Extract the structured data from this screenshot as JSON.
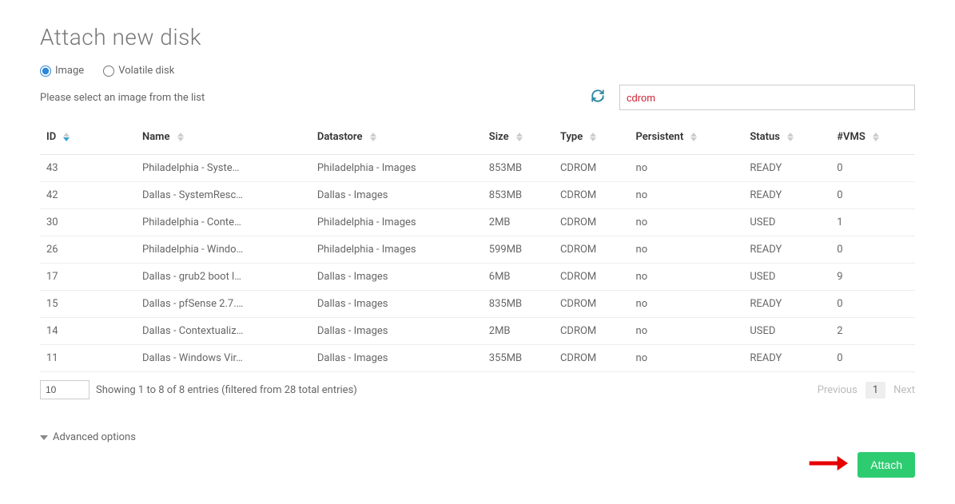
{
  "title": "Attach new disk",
  "radios": {
    "image": "Image",
    "volatile": "Volatile disk",
    "selected": "image"
  },
  "prompt": "Please select an image from the list",
  "search": {
    "value": "cdrom",
    "placeholder": ""
  },
  "columns": [
    "ID",
    "Name",
    "Datastore",
    "Size",
    "Type",
    "Persistent",
    "Status",
    "#VMS"
  ],
  "rows": [
    {
      "id": "43",
      "name": "Philadelphia - Syste…",
      "datastore": "Philadelphia - Images",
      "size": "853MB",
      "type": "CDROM",
      "persistent": "no",
      "status": "READY",
      "vms": "0"
    },
    {
      "id": "42",
      "name": "Dallas - SystemResc…",
      "datastore": "Dallas - Images",
      "size": "853MB",
      "type": "CDROM",
      "persistent": "no",
      "status": "READY",
      "vms": "0"
    },
    {
      "id": "30",
      "name": "Philadelphia - Conte…",
      "datastore": "Philadelphia - Images",
      "size": "2MB",
      "type": "CDROM",
      "persistent": "no",
      "status": "USED",
      "vms": "1"
    },
    {
      "id": "26",
      "name": "Philadelphia - Windo…",
      "datastore": "Philadelphia - Images",
      "size": "599MB",
      "type": "CDROM",
      "persistent": "no",
      "status": "READY",
      "vms": "0"
    },
    {
      "id": "17",
      "name": "Dallas - grub2 boot l…",
      "datastore": "Dallas - Images",
      "size": "6MB",
      "type": "CDROM",
      "persistent": "no",
      "status": "USED",
      "vms": "9"
    },
    {
      "id": "15",
      "name": "Dallas - pfSense 2.7.…",
      "datastore": "Dallas - Images",
      "size": "835MB",
      "type": "CDROM",
      "persistent": "no",
      "status": "READY",
      "vms": "0"
    },
    {
      "id": "14",
      "name": "Dallas - Contextualiz…",
      "datastore": "Dallas - Images",
      "size": "2MB",
      "type": "CDROM",
      "persistent": "no",
      "status": "USED",
      "vms": "2"
    },
    {
      "id": "11",
      "name": "Dallas - Windows Vir…",
      "datastore": "Dallas - Images",
      "size": "355MB",
      "type": "CDROM",
      "persistent": "no",
      "status": "READY",
      "vms": "0"
    }
  ],
  "page_length": "10",
  "footer_info": "Showing 1 to 8 of 8 entries (filtered from 28 total entries)",
  "pager": {
    "prev": "Previous",
    "next": "Next",
    "current": "1"
  },
  "advanced": "Advanced options",
  "attach_label": "Attach"
}
